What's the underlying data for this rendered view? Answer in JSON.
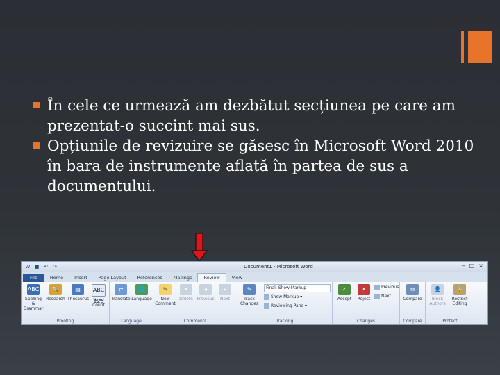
{
  "slide": {
    "bullets": [
      "În cele ce urmează am dezbătut secțiunea pe care am prezentat-o succint mai sus.",
      "Opțiunile de revizuire se găsesc în Microsoft Word 2010 în bara de instrumente aflată în partea de sus a documentului."
    ],
    "accent_color": "#e8742b",
    "arrow_color": "#e0141b"
  },
  "ribbon": {
    "window_title": "Document1 - Microsoft Word",
    "tabs": [
      "File",
      "Home",
      "Insert",
      "Page Layout",
      "References",
      "Mailings",
      "Review",
      "View"
    ],
    "active_tab": "Review",
    "groups": {
      "proofing": {
        "label": "Proofing",
        "spelling": "Spelling & Grammar",
        "research": "Research",
        "thesaurus": "Thesaurus",
        "word_count": "Word Count",
        "abc": "ABC",
        "abc123": "ABC 123"
      },
      "language": {
        "label": "Language",
        "translate": "Translate",
        "language": "Language"
      },
      "comments": {
        "label": "Comments",
        "new": "New Comment",
        "delete": "Delete",
        "previous": "Previous",
        "next": "Next"
      },
      "tracking": {
        "label": "Tracking",
        "track_changes": "Track Changes",
        "final_show_markup": "Final: Show Markup",
        "show_markup": "Show Markup",
        "reviewing_pane": "Reviewing Pane"
      },
      "changes": {
        "label": "Changes",
        "accept": "Accept",
        "reject": "Reject",
        "previous": "Previous",
        "next": "Next"
      },
      "compare": {
        "label": "Compare",
        "compare": "Compare"
      },
      "protect": {
        "label": "Protect",
        "block_authors": "Block Authors",
        "restrict_editing": "Restrict Editing"
      }
    }
  }
}
